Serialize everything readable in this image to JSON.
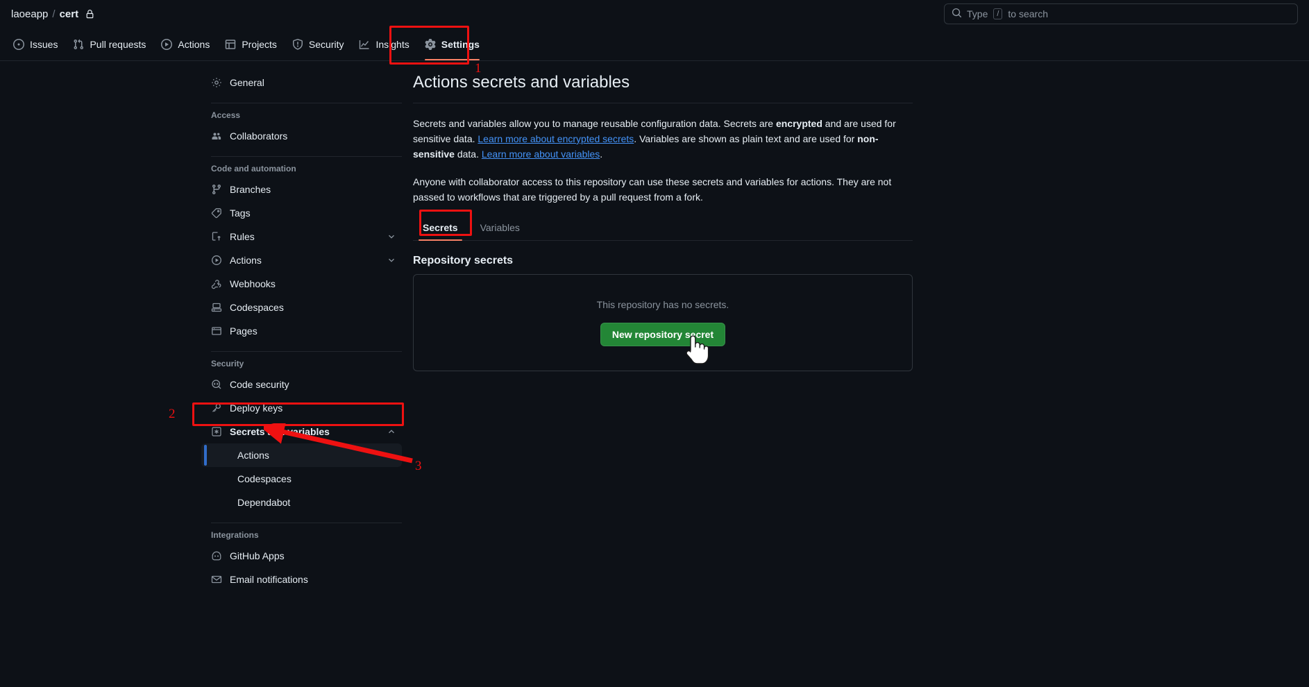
{
  "header": {
    "owner": "laoeapp",
    "separator": "/",
    "repo": "cert",
    "lock_icon": "lock-icon",
    "search_prefix": "Type",
    "search_key": "/",
    "search_suffix": "to search",
    "search_icon": "search-icon"
  },
  "repo_nav": [
    {
      "label": "Issues",
      "icon": "issue-opened-icon",
      "active": false
    },
    {
      "label": "Pull requests",
      "icon": "git-pull-request-icon",
      "active": false
    },
    {
      "label": "Actions",
      "icon": "play-icon",
      "active": false
    },
    {
      "label": "Projects",
      "icon": "table-icon",
      "active": false
    },
    {
      "label": "Security",
      "icon": "shield-icon",
      "active": false
    },
    {
      "label": "Insights",
      "icon": "graph-icon",
      "active": false
    },
    {
      "label": "Settings",
      "icon": "gear-icon",
      "active": true
    }
  ],
  "sidebar": {
    "general": {
      "label": "General",
      "icon": "gear-icon"
    },
    "groups": [
      {
        "title": "Access",
        "items": [
          {
            "label": "Collaborators",
            "icon": "people-icon"
          }
        ]
      },
      {
        "title": "Code and automation",
        "items": [
          {
            "label": "Branches",
            "icon": "git-branch-icon"
          },
          {
            "label": "Tags",
            "icon": "tag-icon"
          },
          {
            "label": "Rules",
            "icon": "rules-icon",
            "chevron": "chevron-down-icon"
          },
          {
            "label": "Actions",
            "icon": "play-icon",
            "chevron": "chevron-down-icon"
          },
          {
            "label": "Webhooks",
            "icon": "webhook-icon"
          },
          {
            "label": "Codespaces",
            "icon": "codespaces-icon"
          },
          {
            "label": "Pages",
            "icon": "browser-icon"
          }
        ]
      },
      {
        "title": "Security",
        "items": [
          {
            "label": "Code security",
            "icon": "code-scan-icon"
          },
          {
            "label": "Deploy keys",
            "icon": "key-icon"
          },
          {
            "label": "Secrets and variables",
            "icon": "asterisk-key-icon",
            "chevron": "chevron-up-icon",
            "bold": true,
            "children": [
              {
                "label": "Actions",
                "selected": true
              },
              {
                "label": "Codespaces",
                "selected": false
              },
              {
                "label": "Dependabot",
                "selected": false
              }
            ]
          }
        ]
      },
      {
        "title": "Integrations",
        "items": [
          {
            "label": "GitHub Apps",
            "icon": "github-apps-icon"
          },
          {
            "label": "Email notifications",
            "icon": "mail-icon"
          }
        ]
      }
    ]
  },
  "main": {
    "title": "Actions secrets and variables",
    "para1": {
      "t1": "Secrets and variables allow you to manage reusable configuration data. Secrets are ",
      "b1": "encrypted",
      "t2": " and are used for sensitive data. ",
      "link1": "Learn more about encrypted secrets",
      "t3": ". Variables are shown as plain text and are used for ",
      "b2": "non-sensitive",
      "t4": " data. ",
      "link2": "Learn more about variables",
      "t5": "."
    },
    "para2": "Anyone with collaborator access to this repository can use these secrets and variables for actions. They are not passed to workflows that are triggered by a pull request from a fork.",
    "tabs": [
      {
        "label": "Secrets",
        "active": true
      },
      {
        "label": "Variables",
        "active": false
      }
    ],
    "section_heading": "Repository secrets",
    "empty_message": "This repository has no secrets.",
    "new_secret_button": "New repository secret"
  },
  "annotations": {
    "one": "1",
    "two": "2",
    "three": "3",
    "accent_color": "#ee1111"
  },
  "colors": {
    "background": "#0d1117",
    "green_button": "#238636",
    "link": "#4493f8",
    "active_underline": "#f78166",
    "selected_bar": "#316dca"
  }
}
